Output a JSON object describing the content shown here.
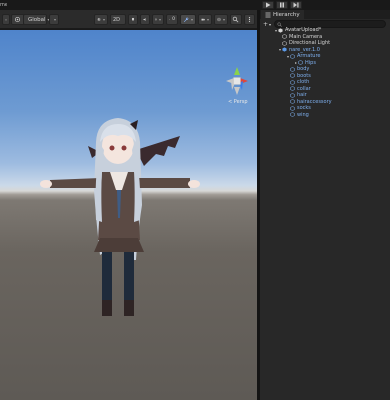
{
  "top": {
    "scene_tab_label": "me",
    "play_icon": "play-icon",
    "pause_icon": "pause-icon",
    "step_icon": "step-icon"
  },
  "scene_toolbar": {
    "pivot_label": "",
    "global_label": "Global"
  },
  "gizmo": {
    "projection_label": "< Persp",
    "colors": {
      "x": "#e0453a",
      "y": "#8bd24a",
      "z": "#3b7ce8"
    }
  },
  "hierarchy": {
    "tab_label": "Hierarchy",
    "add_label": "+",
    "items": [
      {
        "label": "AvatarUpload*",
        "type": "scene",
        "expanded": true
      },
      {
        "label": "Main Camera",
        "type": "object"
      },
      {
        "label": "Directional Light",
        "type": "object"
      },
      {
        "label": "nare_ver.1.0",
        "type": "prefab-root",
        "expanded": true
      },
      {
        "label": "Armature",
        "type": "prefab",
        "expanded": true
      },
      {
        "label": "Hips",
        "type": "prefab"
      },
      {
        "label": "body",
        "type": "prefab"
      },
      {
        "label": "boots",
        "type": "prefab"
      },
      {
        "label": "cloth",
        "type": "prefab"
      },
      {
        "label": "collar",
        "type": "prefab"
      },
      {
        "label": "hair",
        "type": "prefab"
      },
      {
        "label": "hairaccessory",
        "type": "prefab"
      },
      {
        "label": "socks",
        "type": "prefab"
      },
      {
        "label": "wing",
        "type": "prefab"
      }
    ]
  },
  "colors": {
    "panel_bg": "#282828",
    "prefab_text": "#7fb0ee",
    "sky_top": "#4f84cb",
    "ground": "#5e5a55"
  }
}
